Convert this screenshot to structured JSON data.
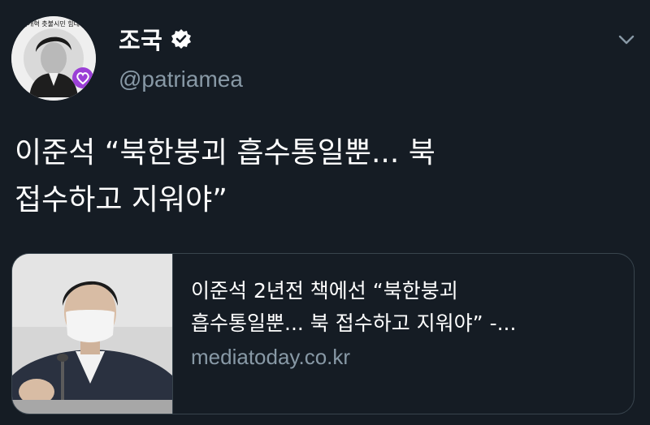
{
  "tweet": {
    "display_name": "조국",
    "handle": "@patriamea",
    "verified_icon": "verified-badge-icon",
    "menu_icon": "chevron-down-icon",
    "text_line1": "이준석 “북한붕괴 흡수통일뿐... 북",
    "text_line2": "접수하고 지워야”"
  },
  "avatar": {
    "badge_icon": "heart-badge-icon",
    "ring_text": "검찰개혁 촛불시민 힘내세요"
  },
  "link_card": {
    "title_line1": "이준석 2년전 책에선 “북한붕괴",
    "title_line2": "흡수통일뿐... 북 접수하고 지워야” -...",
    "domain": "mediatoday.co.kr",
    "image_icon": "article-thumbnail-image"
  },
  "colors": {
    "background": "#151c24",
    "secondary_text": "#8899a6",
    "border": "#38444d",
    "verified_badge": "#ffffff",
    "avatar_badge": "#9b3fd6"
  }
}
